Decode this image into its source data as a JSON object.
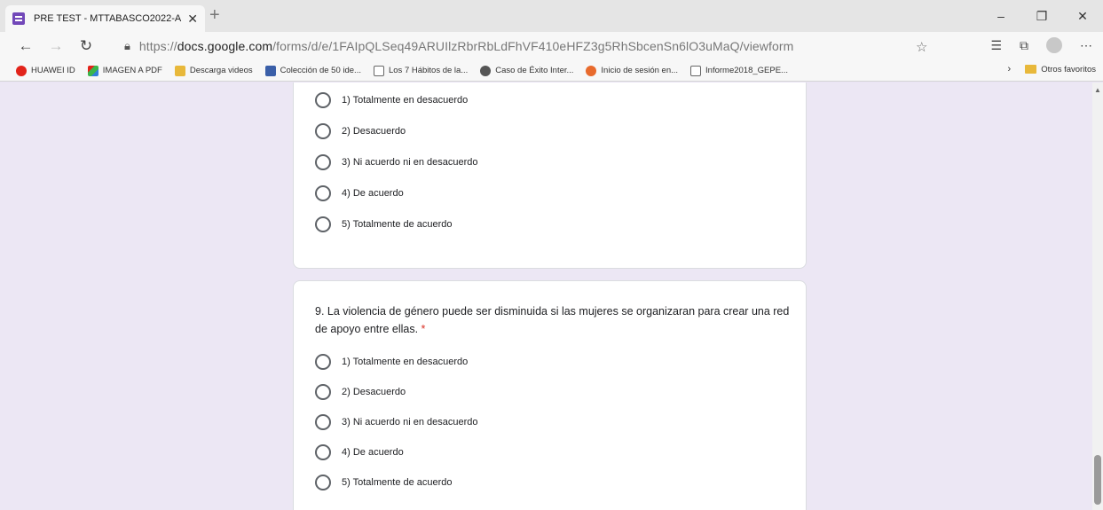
{
  "browser": {
    "tab_title": "PRE TEST - MTTABASCO2022-A",
    "tab_close": "✕",
    "new_tab": "+",
    "url_prefix": "https://",
    "url_domain": "docs.google.com",
    "url_path": "/forms/d/e/1FAIpQLSeq49ARUIlzRbrRbLdFhVF410eHFZ3g5RhSbcenSn6lO3uMaQ/viewform",
    "window_controls": [
      "–",
      "❐",
      "✕"
    ]
  },
  "bookmarks": [
    {
      "label": "HUAWEI ID",
      "icon": "huawei-icon",
      "color": "#e2231a"
    },
    {
      "label": "IMAGEN A PDF",
      "icon": "image-pdf-icon",
      "color": "#2f7fd8"
    },
    {
      "label": "Descarga videos",
      "icon": "folder-icon",
      "color": "#e8b83a"
    },
    {
      "label": "Colección de 50 ide...",
      "icon": "ie-icon",
      "color": "#3a5fa8"
    },
    {
      "label": "Los 7 Hábitos de la...",
      "icon": "page-icon",
      "color": "#ffffff"
    },
    {
      "label": "Caso de Éxito Inter...",
      "icon": "globe-icon",
      "color": "#555555"
    },
    {
      "label": "Inicio de sesión en...",
      "icon": "link-icon",
      "color": "#e86a2c"
    },
    {
      "label": "Informe2018_GEPE...",
      "icon": "page-icon",
      "color": "#ffffff"
    }
  ],
  "other_favorites": "Otros favoritos",
  "question8": {
    "options": [
      "1) Totalmente en desacuerdo",
      "2) Desacuerdo",
      "3) Ni acuerdo ni en desacuerdo",
      "4) De acuerdo",
      "5) Totalmente de acuerdo"
    ]
  },
  "question9": {
    "title": "9. La violencia de género puede ser disminuida si las mujeres se organizaran para crear una red de apoyo entre ellas.",
    "required_mark": "*",
    "options": [
      "1) Totalmente en desacuerdo",
      "2) Desacuerdo",
      "3) Ni acuerdo ni en desacuerdo",
      "4) De acuerdo",
      "5) Totalmente de acuerdo"
    ]
  },
  "colors": {
    "accent": "#7248b9",
    "background": "#ece7f4",
    "required": "#d93025"
  }
}
